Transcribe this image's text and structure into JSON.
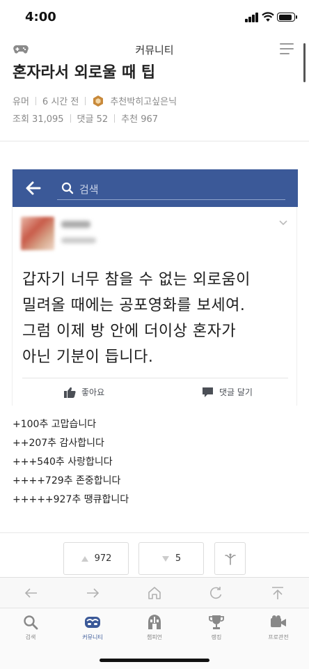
{
  "status_bar": {
    "time": "4:00"
  },
  "nav": {
    "title": "커뮤니티"
  },
  "post": {
    "title": "혼자라서 외로울 때 팁",
    "category": "유머",
    "time_ago": "6 시간 전",
    "author": "추천박히고싶은닉",
    "views": "조회 31,095",
    "comments": "댓글 52",
    "recommend": "추천 967"
  },
  "embedded": {
    "search_placeholder": "검색",
    "lines": [
      "갑자기 너무 참을 수 없는 외로움이",
      "밀려올 때에는 공포영화를 보세여.",
      "그럼 이제 방 안에 더이상 혼자가",
      "아닌 기분이 듭니다."
    ],
    "like_label": "좋아요",
    "comment_label": "댓글 달기"
  },
  "thanks": [
    "+100추 고맙습니다",
    "++207추 감사합니다",
    "+++540추 사랑합니다",
    "++++729추 존중합니다",
    "+++++927추 땡큐합니다"
  ],
  "votes": {
    "up": "972",
    "down": "5"
  },
  "tabs": [
    {
      "label": "검색",
      "icon": "search-icon"
    },
    {
      "label": "커뮤니티",
      "icon": "community-icon"
    },
    {
      "label": "챔피언",
      "icon": "champion-icon"
    },
    {
      "label": "랭킹",
      "icon": "trophy-icon"
    },
    {
      "label": "프로관전",
      "icon": "video-camera-icon"
    }
  ],
  "colors": {
    "facebook_blue": "#3b5998",
    "active_tab": "#3b5998",
    "rank_badge": "#c8893a"
  }
}
